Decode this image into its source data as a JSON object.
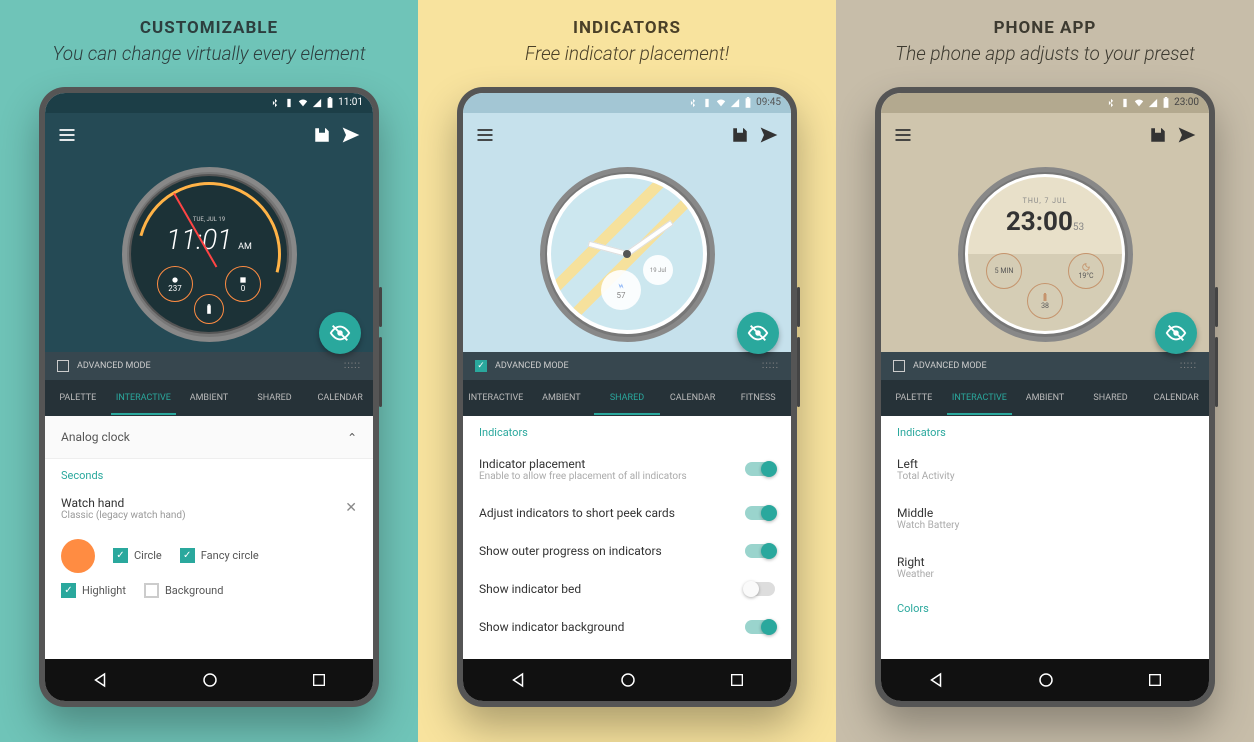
{
  "panels": {
    "p1": {
      "title": "CUSTOMIZABLE",
      "subtitle": "You can change virtually every element",
      "status_time": "11:01",
      "advanced_mode_label": "ADVANCED MODE",
      "advanced_mode_checked": false,
      "tabs": [
        "PALETTE",
        "INTERACTIVE",
        "AMBIENT",
        "SHARED",
        "CALENDAR"
      ],
      "active_tab": "INTERACTIVE",
      "expand_label": "Analog clock",
      "section_label": "Seconds",
      "watch_hand_title": "Watch hand",
      "watch_hand_sub": "Classic (legacy watch hand)",
      "checks": {
        "circle": "Circle",
        "fancy": "Fancy circle",
        "highlight": "Highlight",
        "background": "Background"
      },
      "watch": {
        "date": "TUE, JUL 19",
        "time": "11:01",
        "ampm": "AM",
        "sub_left": "237",
        "sub_right": "0"
      }
    },
    "p2": {
      "title": "INDICATORS",
      "subtitle": "Free indicator placement!",
      "status_time": "09:45",
      "advanced_mode_label": "ADVANCED MODE",
      "advanced_mode_checked": true,
      "tabs": [
        "INTERACTIVE",
        "AMBIENT",
        "SHARED",
        "CALENDAR",
        "FITNESS"
      ],
      "active_tab": "SHARED",
      "section_label": "Indicators",
      "settings": [
        {
          "title": "Indicator placement",
          "sub": "Enable to allow free placement of all indicators",
          "on": true
        },
        {
          "title": "Adjust indicators to short peek cards",
          "sub": "",
          "on": true
        },
        {
          "title": "Show outer progress on indicators",
          "sub": "",
          "on": true
        },
        {
          "title": "Show indicator bed",
          "sub": "",
          "on": false
        },
        {
          "title": "Show indicator background",
          "sub": "",
          "on": true
        }
      ],
      "watch": {
        "bubble_value": "57",
        "bubble_date": "19 Jul"
      }
    },
    "p3": {
      "title": "PHONE APP",
      "subtitle": "The phone app adjusts to your preset",
      "status_time": "23:00",
      "advanced_mode_label": "ADVANCED MODE",
      "advanced_mode_checked": false,
      "tabs": [
        "PALETTE",
        "INTERACTIVE",
        "AMBIENT",
        "SHARED",
        "CALENDAR"
      ],
      "active_tab": "INTERACTIVE",
      "section_indicators": "Indicators",
      "section_colors": "Colors",
      "items": [
        {
          "title": "Left",
          "sub": "Total Activity"
        },
        {
          "title": "Middle",
          "sub": "Watch Battery"
        },
        {
          "title": "Right",
          "sub": "Weather"
        }
      ],
      "watch": {
        "date": "THU, 7 JUL",
        "time": "23:00",
        "seconds": "53",
        "sub_left": "5 MIN",
        "sub_right": "19°C",
        "sub_bottom": "38"
      }
    }
  },
  "colors": {
    "accent": "#2aa89d",
    "orange": "#ff8c42"
  }
}
